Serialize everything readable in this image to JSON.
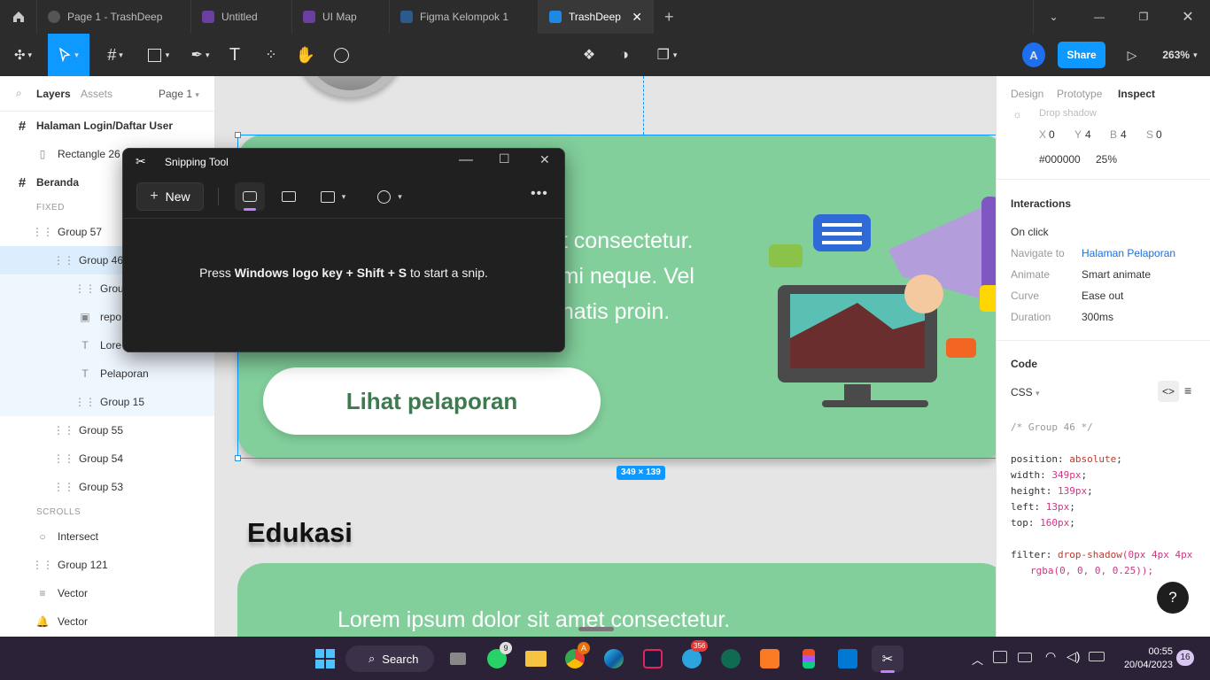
{
  "tabs": [
    {
      "label": "Page 1 - TrashDeep"
    },
    {
      "label": "Untitled"
    },
    {
      "label": "UI Map"
    },
    {
      "label": "Figma Kelompok 1"
    },
    {
      "label": "TrashDeep",
      "active": true
    }
  ],
  "toolbar": {
    "user_initial": "A",
    "share_label": "Share",
    "zoom": "263%"
  },
  "left_panel": {
    "tabs": {
      "layers": "Layers",
      "assets": "Assets",
      "page": "Page 1"
    },
    "layers": [
      {
        "label": "Halaman Login/Daftar User",
        "icon": "frame-icon"
      },
      {
        "label": "Rectangle 26",
        "icon": "rectangle-icon"
      },
      {
        "label": "Beranda",
        "icon": "frame-icon"
      },
      {
        "label": "FIXED",
        "section": true
      },
      {
        "label": "Group 57",
        "icon": "group-icon"
      },
      {
        "label": "Group 46",
        "icon": "group-icon",
        "selected": true
      },
      {
        "label": "Grou",
        "icon": "group-icon"
      },
      {
        "label": "repo",
        "icon": "image-icon"
      },
      {
        "label": "Lore",
        "icon": "text-icon"
      },
      {
        "label": "Pelaporan",
        "icon": "text-icon"
      },
      {
        "label": "Group 15",
        "icon": "group-icon"
      },
      {
        "label": "Group 55",
        "icon": "group-icon"
      },
      {
        "label": "Group 54",
        "icon": "group-icon"
      },
      {
        "label": "Group 53",
        "icon": "group-icon"
      },
      {
        "label": "SCROLLS",
        "section": true
      },
      {
        "label": "Intersect",
        "icon": "ellipse-icon"
      },
      {
        "label": "Group 121",
        "icon": "group-icon"
      },
      {
        "label": "Vector",
        "icon": "vector-icon"
      },
      {
        "label": "Vector",
        "icon": "vector-bell-icon"
      }
    ]
  },
  "canvas": {
    "banner_text": [
      "et consectetur.",
      "l mi neque. Vel",
      "enatis proin."
    ],
    "banner_button": "Lihat pelaporan",
    "size_badge": "349 × 139",
    "heading": "Edukasi",
    "card_text": "Lorem ipsum dolor sit amet consectetur."
  },
  "right_panel": {
    "tabs": {
      "design": "Design",
      "prototype": "Prototype",
      "inspect": "Inspect"
    },
    "effect": {
      "name": "Drop shadow",
      "x_label": "X",
      "x": "0",
      "y_label": "Y",
      "y": "4",
      "b_label": "B",
      "b": "4",
      "s_label": "S",
      "s": "0",
      "color": "#000000",
      "opacity": "25%"
    },
    "interactions": {
      "title": "Interactions",
      "trigger": "On click",
      "navigate_label": "Navigate to",
      "navigate_value": "Halaman Pelaporan",
      "animate_label": "Animate",
      "animate_value": "Smart animate",
      "curve_label": "Curve",
      "curve_value": "Ease out",
      "duration_label": "Duration",
      "duration_value": "300ms"
    },
    "code": {
      "title": "Code",
      "language": "CSS",
      "comment": "/* Group 46 */",
      "lines": [
        {
          "prop": "position:",
          "val": "absolute"
        },
        {
          "prop": "width:",
          "val": "349px"
        },
        {
          "prop": "height:",
          "val": "139px"
        },
        {
          "prop": "left:",
          "val": "13px"
        },
        {
          "prop": "top:",
          "val": "160px"
        }
      ],
      "filter_prop": "filter:",
      "filter_fn": "drop-shadow",
      "filter_args": "(0px 4px 4px",
      "filter_args2": "rgba(0, 0, 0, 0.25));"
    },
    "help": "?"
  },
  "snipping_tool": {
    "title": "Snipping Tool",
    "new_label": "New",
    "message_pre": "Press ",
    "message_bold": "Windows logo key + Shift + S",
    "message_post": " to start a snip."
  },
  "taskbar": {
    "search_label": "Search",
    "whatsapp_badge": "9",
    "chrome_badge": "A",
    "telegram_badge": "356",
    "time": "00:55",
    "date": "20/04/2023",
    "notifications": "16"
  },
  "colors": {
    "accent": "#0d99ff",
    "banner": "#82cf9b",
    "button_text": "#3d7a4f",
    "taskbar": "#2b2238"
  }
}
